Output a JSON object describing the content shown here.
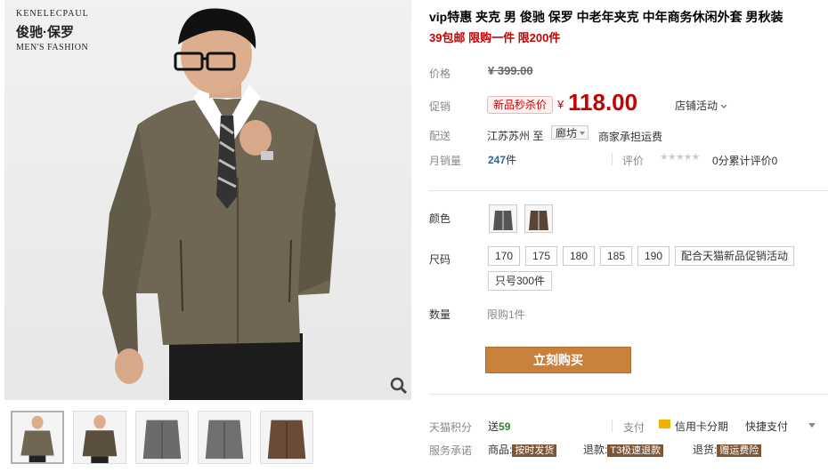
{
  "brand": {
    "arc_text": "KENELECPAUL",
    "cn_name": "俊驰·保罗",
    "en_name": "MEN'S FASHION"
  },
  "product": {
    "title": "vip特惠 夹克 男 俊驰 保罗 中老年夹克 中年商务休闲外套 男秋装",
    "subtitle": "39包邮 限购一件 限200件"
  },
  "price": {
    "label": "价格",
    "original": "¥ 399.00",
    "promo_label": "促销",
    "promo_badge": "新品秒杀价",
    "currency": "¥",
    "current": "118.00",
    "shop_activity": "店铺活动"
  },
  "shipping": {
    "label": "配送",
    "origin": "江苏苏州",
    "to": "至",
    "destination": "廊坊",
    "fee": "商家承担运费"
  },
  "sales": {
    "label": "月销量",
    "count": "247",
    "unit": "件",
    "rating_label": "评价",
    "rating_stars": "★★★★★",
    "rating_text": "0分累计评价0"
  },
  "color": {
    "label": "颜色"
  },
  "size": {
    "label": "尺码",
    "options": [
      "170",
      "175",
      "180",
      "185",
      "190"
    ],
    "promo_btn": "配合天猫新品促销活动",
    "limit_btn": "只号300件"
  },
  "quantity": {
    "label": "数量",
    "note": "限购1件"
  },
  "buy_button": "立刻购买",
  "points": {
    "label": "天猫积分",
    "value_prefix": "送",
    "value": "59",
    "pay_label": "支付",
    "credit": "信用卡分期",
    "quick_pay": "快捷支付"
  },
  "service": {
    "label": "服务承诺",
    "goods": "商品:",
    "goods_tag": "按时发货",
    "refund": "退款:",
    "refund_tag": "T3极速退款",
    "return": "退货:",
    "return_tag": "赠运费险"
  },
  "colors": {
    "accent_red": "#c40000",
    "buy_orange": "#c9823d",
    "link_blue": "#2967a3"
  },
  "icons": {
    "zoom": "magnifier-icon",
    "card": "credit-card-icon",
    "chevron": "chevron-down-icon"
  }
}
